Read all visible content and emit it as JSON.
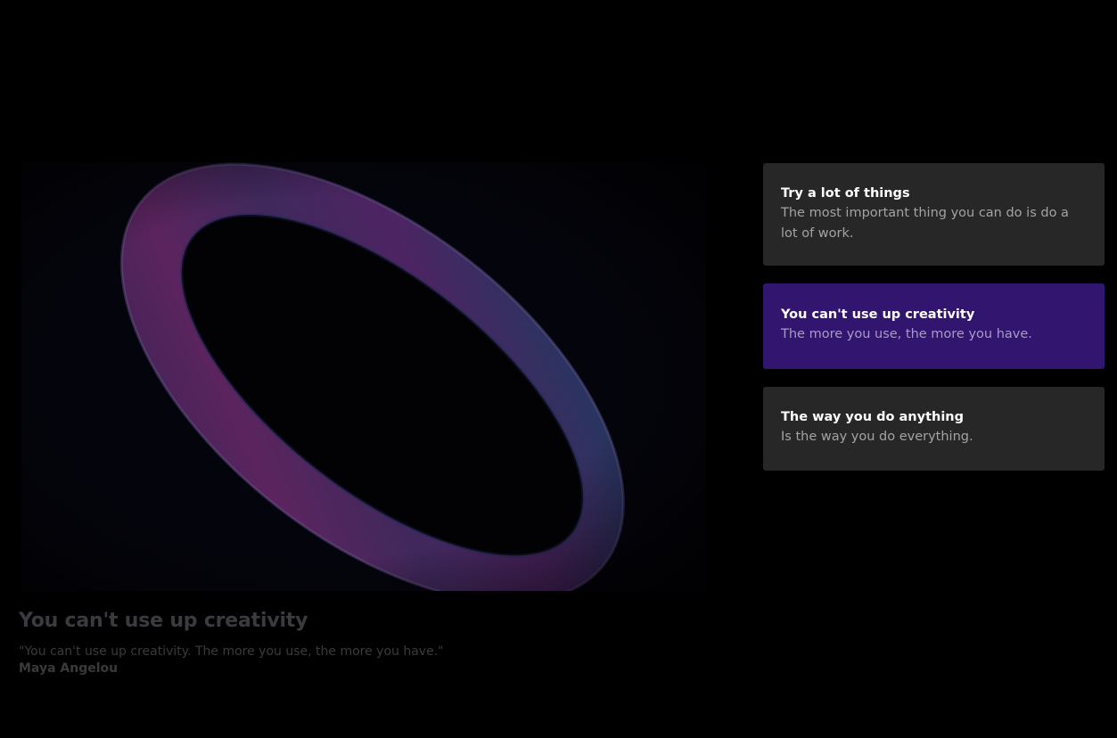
{
  "hero": {
    "image_alt": "abstract iridescent ring"
  },
  "caption": {
    "title": "You can't use up creativity",
    "quote": "\"You can't use up creativity. The more you use, the more you have.\"",
    "author": "Maya Angelou"
  },
  "cards": [
    {
      "title": "Try a lot of things",
      "text": "The most important thing you can do is do a lot of work.",
      "active": false
    },
    {
      "title": "You can't use up creativity",
      "text": "The more you use, the more you have.",
      "active": true
    },
    {
      "title": "The way you do anything",
      "text": "Is the way you do everything.",
      "active": false
    }
  ],
  "colors": {
    "background": "#000000",
    "card": "#272727",
    "card_active": "#32156e",
    "caption_text": "#3b3b3f"
  }
}
